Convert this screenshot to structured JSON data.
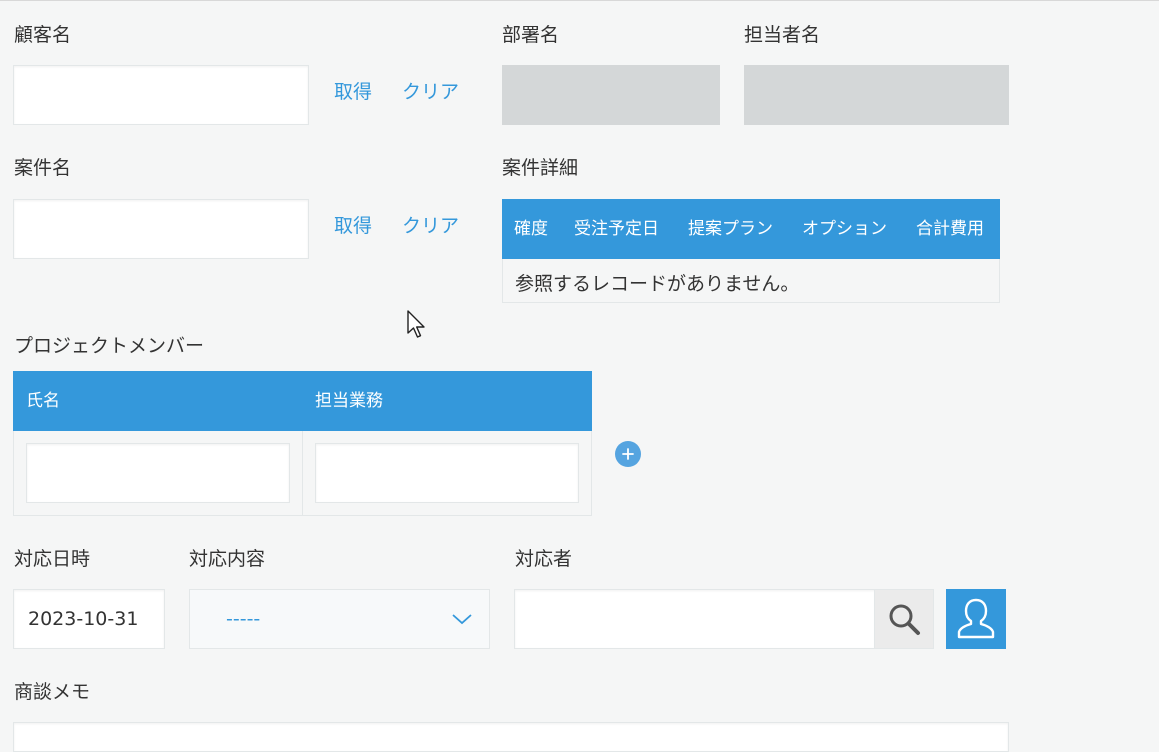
{
  "customer": {
    "label": "顧客名",
    "fetch_label": "取得",
    "clear_label": "クリア"
  },
  "department": {
    "label": "部署名"
  },
  "person_in_charge": {
    "label": "担当者名"
  },
  "deal": {
    "label": "案件名",
    "fetch_label": "取得",
    "clear_label": "クリア"
  },
  "deal_details": {
    "label": "案件詳細",
    "columns": [
      "確度",
      "受注予定日",
      "提案プラン",
      "オプション",
      "合計費用"
    ],
    "empty_message": "参照するレコードがありません。"
  },
  "project_members": {
    "label": "プロジェクトメンバー",
    "columns": [
      "氏名",
      "担当業務"
    ]
  },
  "response_datetime": {
    "label": "対応日時",
    "value": "2023-10-31"
  },
  "response_content": {
    "label": "対応内容",
    "selected": "-----"
  },
  "responder": {
    "label": "対応者"
  },
  "memo": {
    "label": "商談メモ"
  },
  "colors": {
    "accent": "#3498db",
    "background": "#f5f6f6",
    "readonly": "#d4d7d8"
  },
  "icons": {
    "search": "search-icon",
    "user": "user-icon",
    "add": "plus-icon",
    "dropdown": "chevron-down-icon",
    "cursor": "mouse-cursor-icon"
  }
}
